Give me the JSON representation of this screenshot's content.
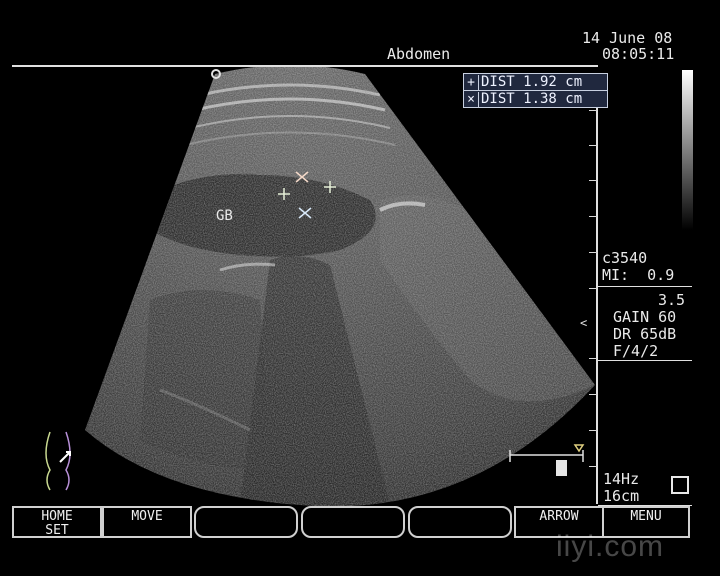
{
  "header": {
    "date": "14 June 08",
    "time": "08:05:11",
    "preset": "Abdomen"
  },
  "measurements": [
    {
      "marker": "+",
      "label": "DIST 1.92 cm"
    },
    {
      "marker": "×",
      "label": "DIST 1.38 cm"
    }
  ],
  "image": {
    "annotation": "GB"
  },
  "probe": {
    "model": "c3540",
    "mi": "MI:  0.9"
  },
  "settings": {
    "freq": "3.5",
    "gain": "GAIN 60",
    "dr": "DR 65dB",
    "f": "F/4/2"
  },
  "status": {
    "frame_rate": "14Hz",
    "depth": "16cm"
  },
  "softkeys": [
    {
      "line1": "HOME",
      "line2": "SET"
    },
    {
      "line1": "MOVE",
      "line2": ""
    },
    {
      "line1": "",
      "line2": ""
    },
    {
      "line1": "",
      "line2": ""
    },
    {
      "line1": "",
      "line2": ""
    },
    {
      "line1": "ARROW",
      "line2": ""
    },
    {
      "line1": "MENU",
      "line2": ""
    }
  ],
  "watermark": "iiyi.com",
  "colors": {
    "background": "#000000",
    "measure_box": "#20283e",
    "text": "#eaeaea"
  }
}
